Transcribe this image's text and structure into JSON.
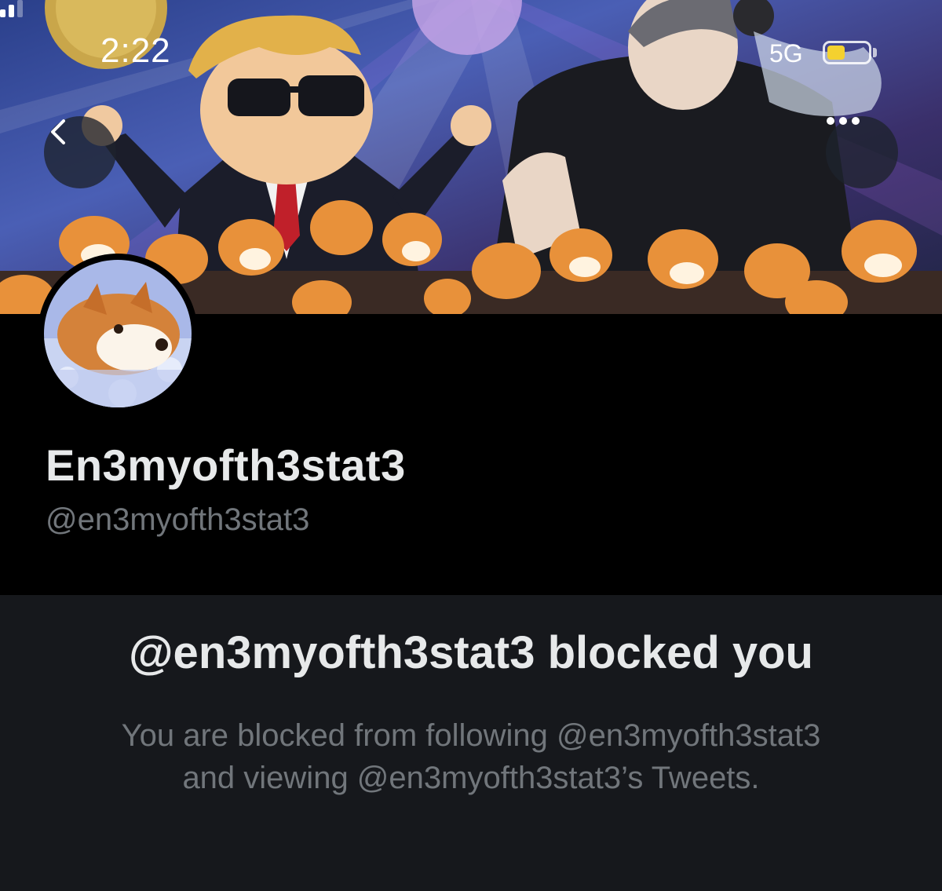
{
  "status_bar": {
    "time": "2:22",
    "network": "5G",
    "battery_color": "#f4d12f",
    "icons": [
      "signal-icon",
      "battery-icon"
    ]
  },
  "nav": {
    "back_icon": "chevron-left-icon",
    "more_icon": "more-horizontal-icon"
  },
  "profile": {
    "display_name": "En3myofth3stat3",
    "handle": "@en3myofth3stat3"
  },
  "blocked": {
    "title": "@en3myofth3stat3 blocked you",
    "message_line1": "You are blocked from following @en3myofth3stat3",
    "message_line2": "and viewing @en3myofth3stat3’s Tweets."
  },
  "colors": {
    "background": "#000000",
    "panel": "#16181c",
    "primary_text": "#e7e9ea",
    "secondary_text": "#71767b"
  }
}
